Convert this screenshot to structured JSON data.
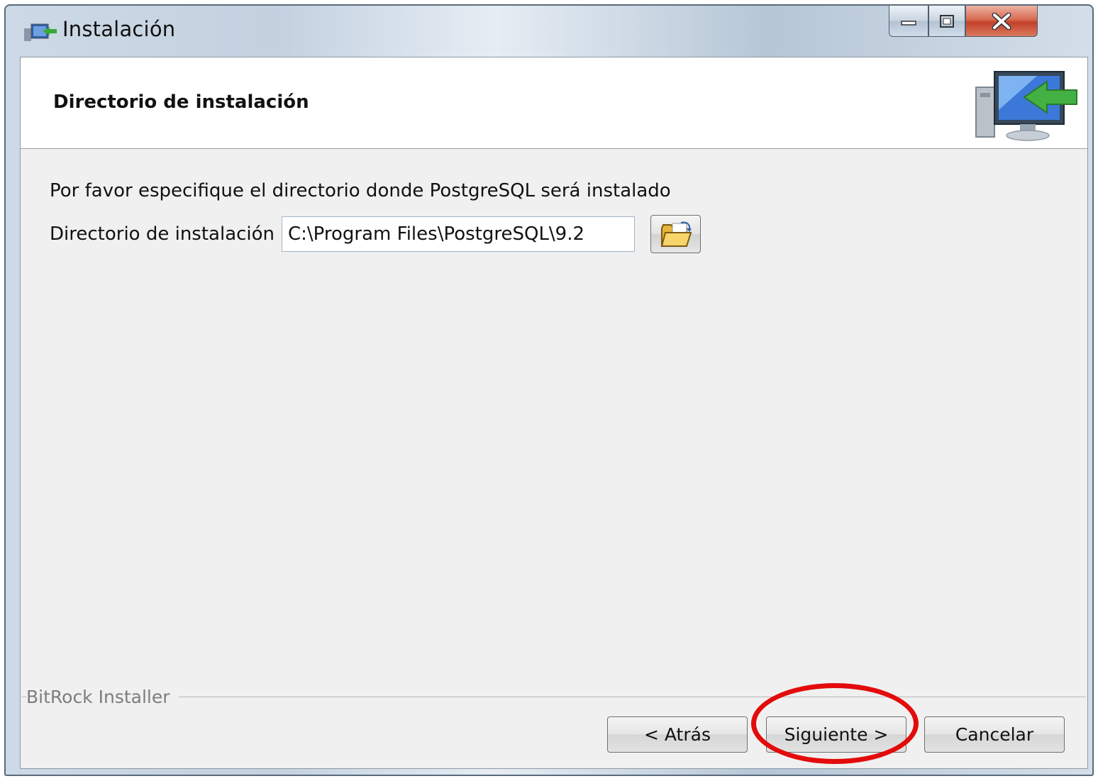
{
  "window": {
    "title": "Instalación",
    "controls": {
      "minimize": "minimize",
      "maximize": "maximize",
      "close": "close"
    }
  },
  "header": {
    "title": "Directorio de instalación"
  },
  "body": {
    "prompt": "Por favor especifique el directorio donde PostgreSQL será instalado",
    "dir_label": "Directorio de instalación",
    "dir_value": "C:\\Program Files\\PostgreSQL\\9.2"
  },
  "footer": {
    "group_label": "BitRock Installer",
    "back_label": "< Atrás",
    "next_label": "Siguiente >",
    "cancel_label": "Cancelar"
  },
  "annotation": {
    "highlight_color": "#e30b0b"
  }
}
